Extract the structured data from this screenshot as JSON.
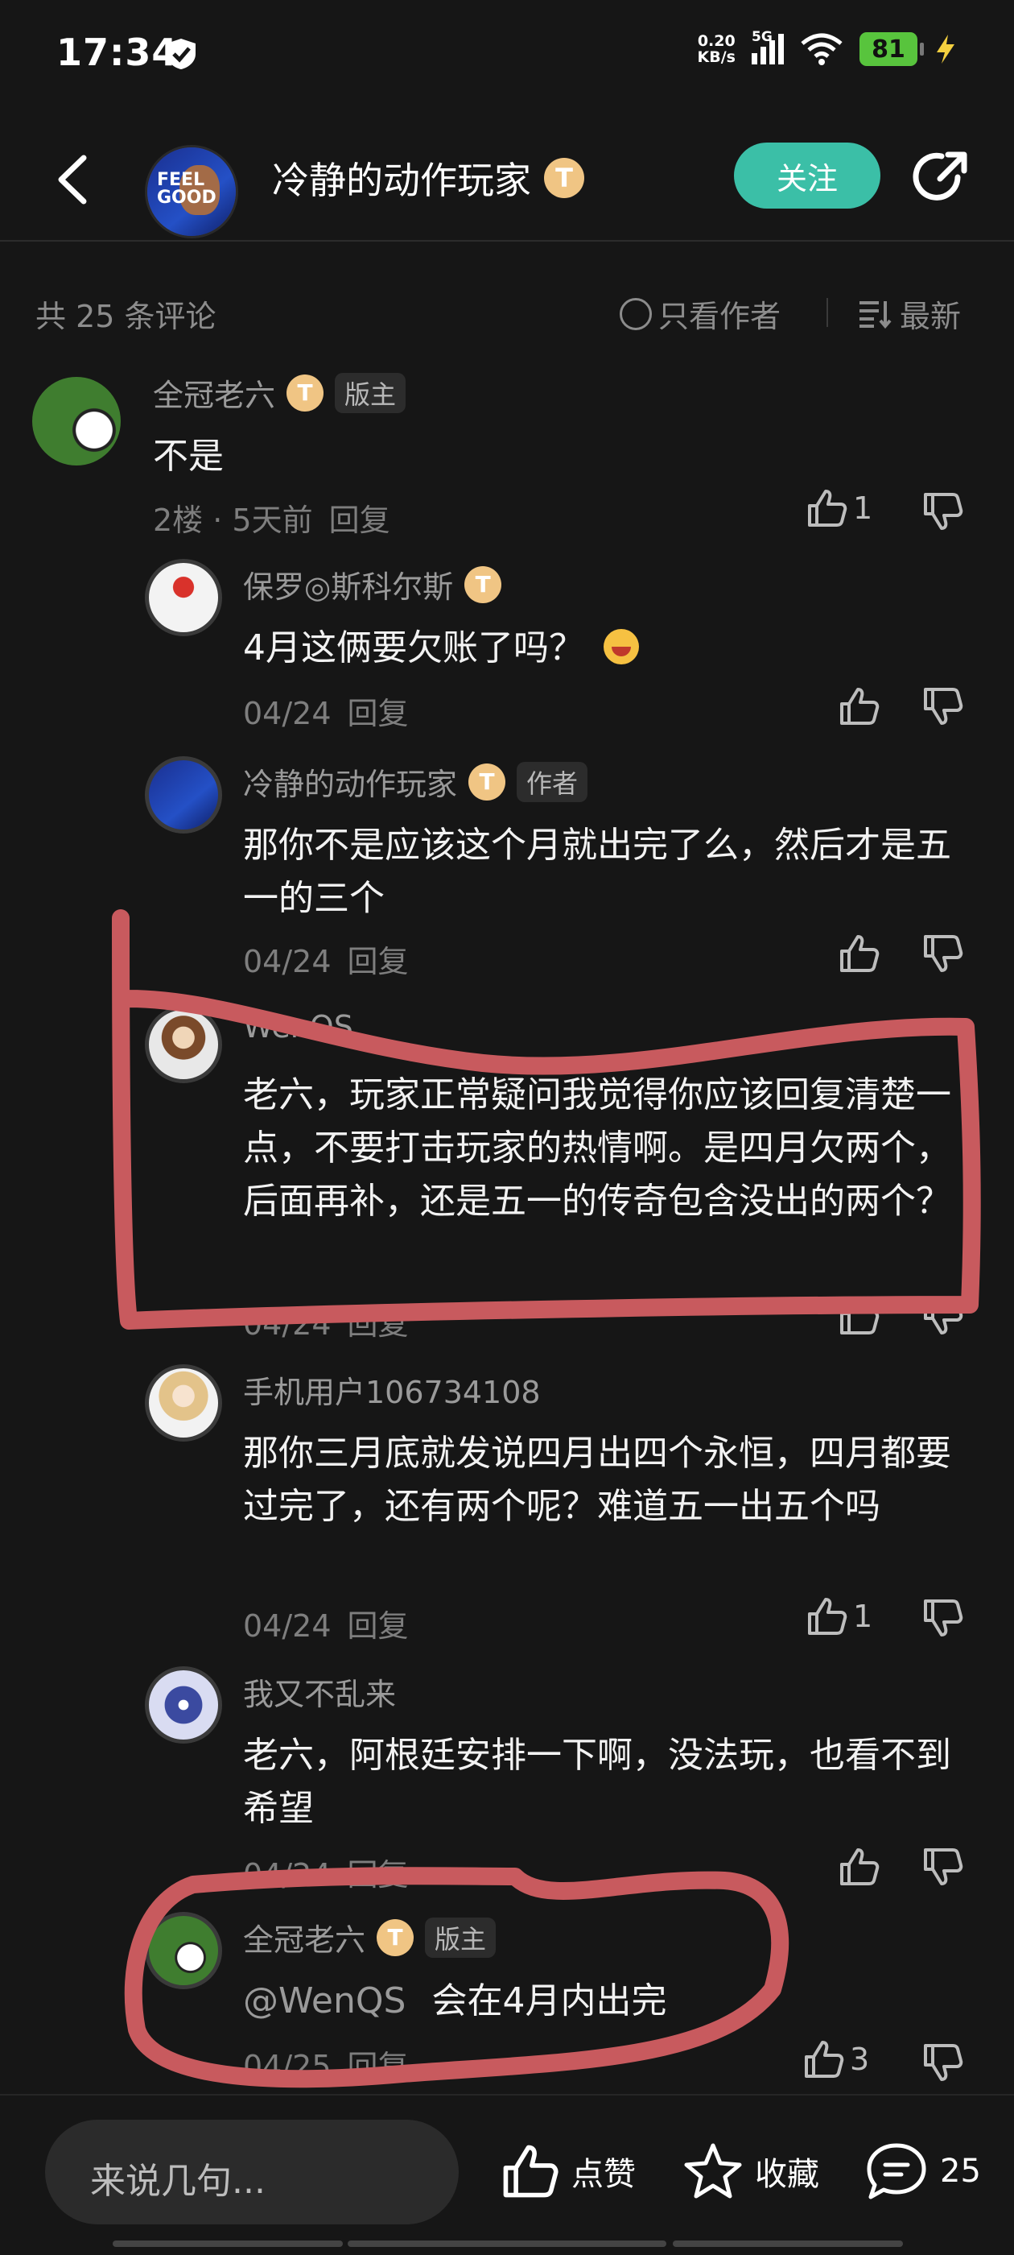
{
  "status_bar": {
    "time": "17:34",
    "net_speed_value": "0.20",
    "net_speed_unit": "KB/s",
    "network": "5G",
    "battery": "81"
  },
  "header": {
    "title": "冷静的动作玩家",
    "badge": "T",
    "follow_label": "关注"
  },
  "filter": {
    "count": "共 25 条评论",
    "author_only": "只看作者",
    "sort": "最新"
  },
  "comments": [
    {
      "author": "全冠老六",
      "badge": "T",
      "role": "版主",
      "text": "不是",
      "meta": "2楼 · 5天前",
      "reply": "回复",
      "likes": "1"
    },
    {
      "author": "保罗◎斯科尔斯",
      "badge": "T",
      "text": "4月这俩要欠账了吗？",
      "meta": "04/24",
      "reply": "回复"
    },
    {
      "author": "冷静的动作玩家",
      "badge": "T",
      "role": "作者",
      "text": "那你不是应该这个月就出完了么，然后才是五一的三个",
      "meta": "04/24",
      "reply": "回复"
    },
    {
      "author": "WenQS",
      "text": "老六，玩家正常疑问我觉得你应该回复清楚一点，不要打击玩家的热情啊。是四月欠两个，后面再补，还是五一的传奇包含没出的两个？",
      "meta": "04/24",
      "reply": "回复"
    },
    {
      "author": "手机用户106734108",
      "text": "那你三月底就发说四月出四个永恒，四月都要过完了，还有两个呢？难道五一出五个吗",
      "meta": "04/24",
      "reply": "回复",
      "likes": "1"
    },
    {
      "author": "我又不乱来",
      "text": "老六，阿根廷安排一下啊，没法玩，也看不到希望",
      "meta": "04/24",
      "reply": "回复"
    },
    {
      "author": "全冠老六",
      "badge": "T",
      "role": "版主",
      "mention": "@WenQS",
      "text": "会在4月内出完",
      "meta": "04/25",
      "reply": "回复",
      "likes": "3"
    }
  ],
  "bottom_bar": {
    "input_placeholder": "来说几句...",
    "like_label": "点赞",
    "favorite_label": "收藏",
    "comment_count": "25"
  }
}
